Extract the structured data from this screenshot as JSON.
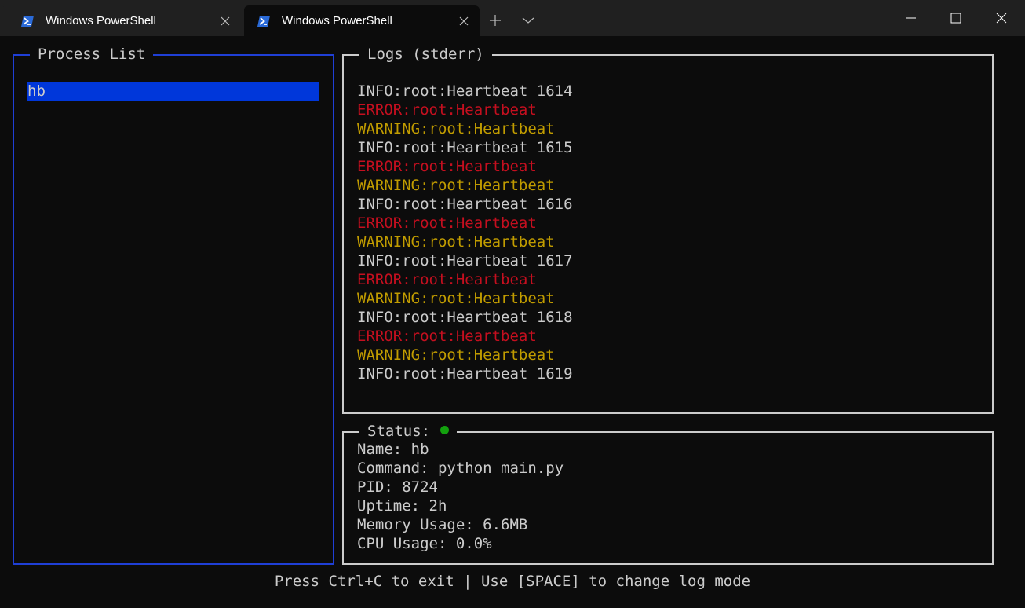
{
  "window": {
    "tabs": [
      {
        "title": "Windows PowerShell",
        "active": false
      },
      {
        "title": "Windows PowerShell",
        "active": true
      }
    ]
  },
  "process_panel": {
    "title": "Process List",
    "items": [
      "hb"
    ],
    "selected": "hb"
  },
  "logs_panel": {
    "title": "Logs (stderr)",
    "lines": [
      {
        "level": "info",
        "text": "INFO:root:Heartbeat 1614"
      },
      {
        "level": "error",
        "text": "ERROR:root:Heartbeat"
      },
      {
        "level": "warning",
        "text": "WARNING:root:Heartbeat"
      },
      {
        "level": "info",
        "text": "INFO:root:Heartbeat 1615"
      },
      {
        "level": "error",
        "text": "ERROR:root:Heartbeat"
      },
      {
        "level": "warning",
        "text": "WARNING:root:Heartbeat"
      },
      {
        "level": "info",
        "text": "INFO:root:Heartbeat 1616"
      },
      {
        "level": "error",
        "text": "ERROR:root:Heartbeat"
      },
      {
        "level": "warning",
        "text": "WARNING:root:Heartbeat"
      },
      {
        "level": "info",
        "text": "INFO:root:Heartbeat 1617"
      },
      {
        "level": "error",
        "text": "ERROR:root:Heartbeat"
      },
      {
        "level": "warning",
        "text": "WARNING:root:Heartbeat"
      },
      {
        "level": "info",
        "text": "INFO:root:Heartbeat 1618"
      },
      {
        "level": "error",
        "text": "ERROR:root:Heartbeat"
      },
      {
        "level": "warning",
        "text": "WARNING:root:Heartbeat"
      },
      {
        "level": "info",
        "text": "INFO:root:Heartbeat 1619"
      }
    ]
  },
  "status_panel": {
    "title": "Status:",
    "indicator_color": "#13a10e",
    "name": "Name: hb",
    "command": "Command: python main.py",
    "pid": "PID: 8724",
    "uptime": "Uptime: 2h",
    "memory": "Memory Usage: 6.6MB",
    "cpu": "CPU Usage: 0.0%"
  },
  "footer": "Press Ctrl+C to exit | Use [SPACE] to change log mode",
  "colors": {
    "info": "#cccccc",
    "error": "#c50f1f",
    "warning": "#c19c00",
    "selection": "#0037da",
    "process_border": "#1f3fd6"
  }
}
